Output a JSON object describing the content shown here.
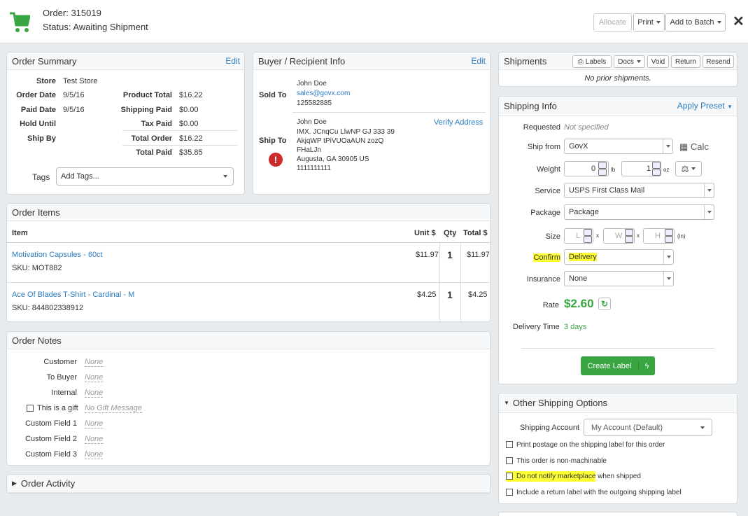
{
  "header": {
    "order": "Order: 315019",
    "status": "Status: Awaiting Shipment",
    "allocate": "Allocate",
    "print": "Print",
    "add_to_batch": "Add to Batch",
    "close": "✕"
  },
  "order_summary": {
    "title": "Order Summary",
    "edit": "Edit",
    "store_label": "Store",
    "store_value": "Test Store",
    "order_date_label": "Order Date",
    "order_date_value": "9/5/16",
    "paid_date_label": "Paid Date",
    "paid_date_value": "9/5/16",
    "hold_until_label": "Hold Until",
    "ship_by_label": "Ship By",
    "product_total_label": "Product Total",
    "product_total_value": "$16.22",
    "shipping_paid_label": "Shipping Paid",
    "shipping_paid_value": "$0.00",
    "tax_paid_label": "Tax Paid",
    "tax_paid_value": "$0.00",
    "total_order_label": "Total Order",
    "total_order_value": "$16.22",
    "total_paid_label": "Total Paid",
    "total_paid_value": "$35.85",
    "tags_label": "Tags",
    "tags_placeholder": "Add Tags..."
  },
  "buyer": {
    "title": "Buyer / Recipient Info",
    "edit": "Edit",
    "sold_to_label": "Sold To",
    "sold_name": "John Doe",
    "sold_email": "sales@govx.com",
    "sold_phone": "125582885",
    "ship_to_label": "Ship To",
    "verify": "Verify Address",
    "ship_name": "John Doe",
    "ship_line1": "IMX. JCnqCu LlwNP GJ 333 39",
    "ship_line2": "AkjqWP tPiVUOaAUN zozQ",
    "ship_line3": "FHaLJn",
    "ship_line4": "Augusta, GA 30905 US",
    "ship_phone": "1111111111",
    "warning": "!"
  },
  "items": {
    "title": "Order Items",
    "col_item": "Item",
    "col_unit": "Unit $",
    "col_qty": "Qty",
    "col_total": "Total $",
    "rows": [
      {
        "name": "Motivation Capsules - 60ct",
        "sku": "SKU: MOT882",
        "unit": "$11.97",
        "qty": "1",
        "total": "$11.97"
      },
      {
        "name": "Ace Of Blades T-Shirt - Cardinal - M",
        "sku": "SKU: 844802338912",
        "unit": "$4.25",
        "qty": "1",
        "total": "$4.25"
      }
    ]
  },
  "notes": {
    "title": "Order Notes",
    "customer_label": "Customer",
    "customer_value": "None",
    "to_buyer_label": "To Buyer",
    "to_buyer_value": "None",
    "internal_label": "Internal",
    "internal_value": "None",
    "gift_label": "This is a gift",
    "gift_value": "No Gift Message",
    "cf1_label": "Custom Field 1",
    "cf1_value": "None",
    "cf2_label": "Custom Field 2",
    "cf2_value": "None",
    "cf3_label": "Custom Field 3",
    "cf3_value": "None"
  },
  "activity": {
    "title": "Order Activity"
  },
  "shipments": {
    "title": "Shipments",
    "labels": "Labels",
    "docs": "Docs",
    "void": "Void",
    "return": "Return",
    "resend": "Resend",
    "empty": "No prior shipments."
  },
  "shipping_info": {
    "title": "Shipping Info",
    "apply_preset": "Apply Preset",
    "requested_label": "Requested",
    "requested_value": "Not specified",
    "ship_from_label": "Ship from",
    "ship_from_value": "GovX",
    "calc": "Calc",
    "weight_label": "Weight",
    "weight_lb": "0",
    "lb_unit": "lb",
    "weight_oz": "1",
    "oz_unit": "oz",
    "service_label": "Service",
    "service_value": "USPS First Class Mail",
    "package_label": "Package",
    "package_value": "Package",
    "size_label": "Size",
    "size_l": "L",
    "size_w": "W",
    "size_h": "H",
    "size_x": "x",
    "size_unit": "(in)",
    "confirm_label": "Confirm",
    "confirm_value": "Delivery",
    "insurance_label": "Insurance",
    "insurance_value": "None",
    "rate_label": "Rate",
    "rate_value": "$2.60",
    "delivery_time_label": "Delivery Time",
    "delivery_time_value": "3 days",
    "create_label": "Create Label"
  },
  "other_options": {
    "title": "Other Shipping Options",
    "account_label": "Shipping Account",
    "account_value": "My Account (Default)",
    "opt1": "Print postage on the shipping label for this order",
    "opt2": "This order is non-machinable",
    "opt3_hl": "Do not notify marketplace",
    "opt3_rest": " when shipped",
    "opt4": "Include a return label with the outgoing shipping label"
  },
  "colors": {
    "link": "#2a7bc0",
    "green": "#3aa543",
    "highlight": "#ffff33",
    "warning": "#cc2b2b"
  }
}
